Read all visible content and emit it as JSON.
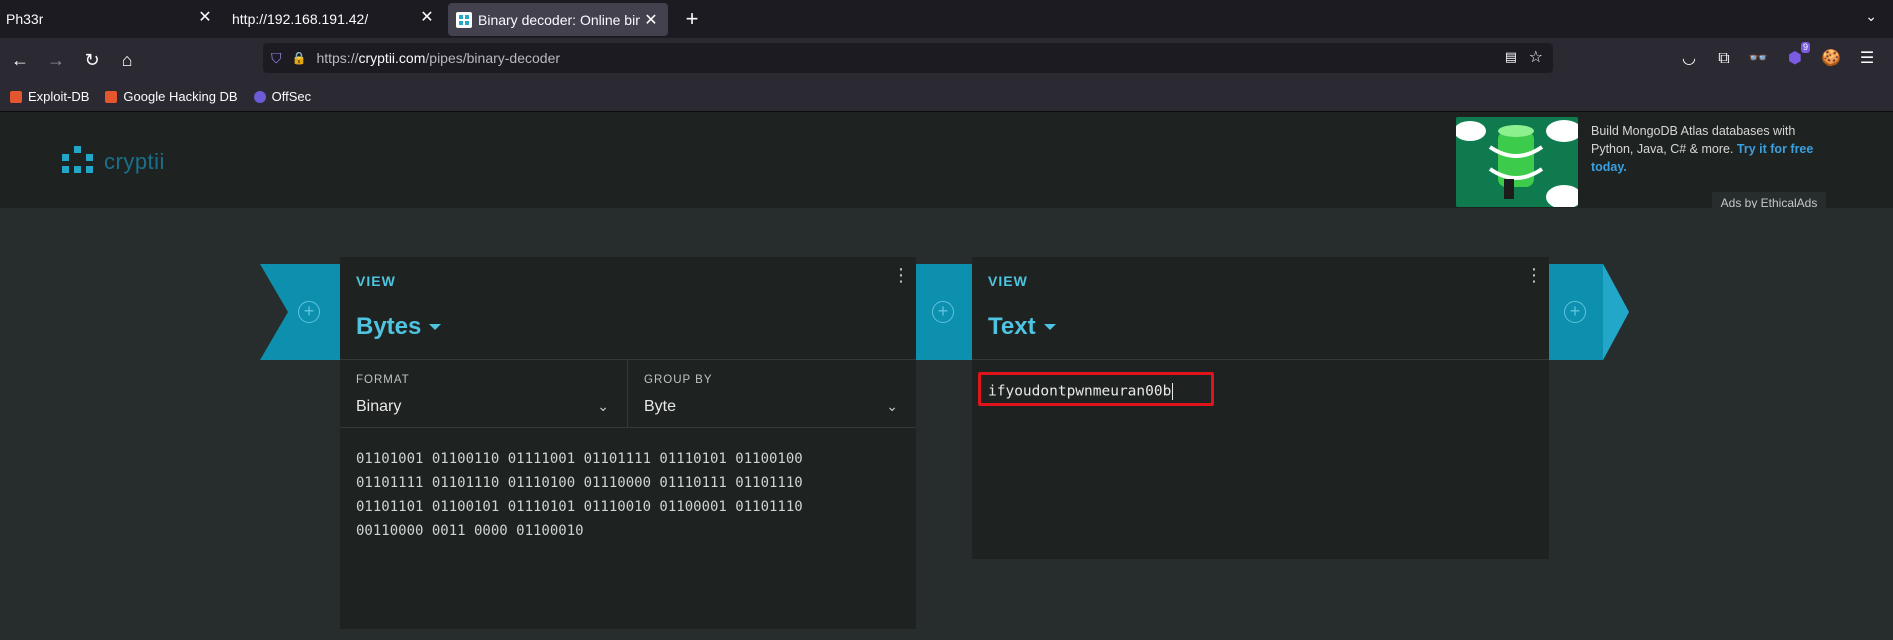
{
  "browser": {
    "tabs": [
      {
        "title": "Ph33r",
        "active": false
      },
      {
        "title": "http://192.168.191.42/",
        "active": false
      },
      {
        "title": "Binary decoder: Online bin",
        "active": true
      }
    ],
    "new_tab_label": "+",
    "url": {
      "scheme": "https://",
      "host": "cryptii.com",
      "path": "/pipes/binary-decoder"
    },
    "bookmarks": [
      {
        "label": "Exploit-DB",
        "color": "#e4572e"
      },
      {
        "label": "Google Hacking DB",
        "color": "#e4572e"
      },
      {
        "label": "OffSec",
        "color": "#6b5bd6"
      }
    ],
    "notification_count": "9"
  },
  "site": {
    "logo_text": "cryptii"
  },
  "ad": {
    "text": "Build MongoDB Atlas databases with Python, Java, C# & more.",
    "link": "Try it for free today.",
    "by": "Ads by EthicalAds"
  },
  "left_brick": {
    "label": "VIEW",
    "name": "Bytes",
    "format_label": "FORMAT",
    "format_value": "Binary",
    "group_label": "GROUP BY",
    "group_value": "Byte",
    "content": "01101001 01100110 01111001 01101111 01110101 01100100\n01101111 01101110 01110100 01110000 01110111 01101110\n01101101 01100101 01110101 01110010 01100001 01101110\n00110000 0011 0000 01100010"
  },
  "right_brick": {
    "label": "VIEW",
    "name": "Text",
    "content": "ifyoudontpwnmeuran00b"
  },
  "colors": {
    "accent": "#4fc4e0",
    "pipe": "#0d8fae",
    "highlight": "#e0141b"
  }
}
